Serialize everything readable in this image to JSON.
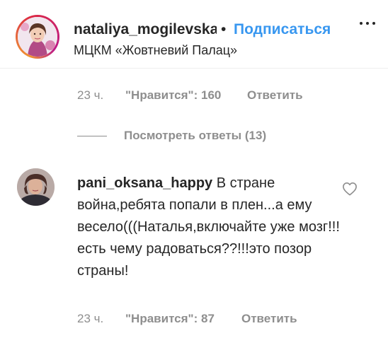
{
  "header": {
    "username": "nataliya_mogilevskaya",
    "separator": "•",
    "follow_label": "Подписаться",
    "location": "МЦКМ «Жовтневий Палац»"
  },
  "top_comment_meta": {
    "time": "23 ч.",
    "likes": "\"Нравится\": 160",
    "reply_label": "Ответить"
  },
  "view_replies_label": "Посмотреть ответы (13)",
  "comment": {
    "username": "pani_oksana_happy",
    "text": "В стране война,ребята попали в плен...а ему весело(((Наталья,включайте уже мозг!!!есть чему радоваться??!!!это позор страны!",
    "time": "23 ч.",
    "likes": "\"Нравится\": 87",
    "reply_label": "Ответить"
  },
  "colors": {
    "link_blue": "#3897f0",
    "muted_gray": "#8e8e8e",
    "text_dark": "#262626"
  },
  "icons": [
    "more-options-icon",
    "heart-icon"
  ]
}
